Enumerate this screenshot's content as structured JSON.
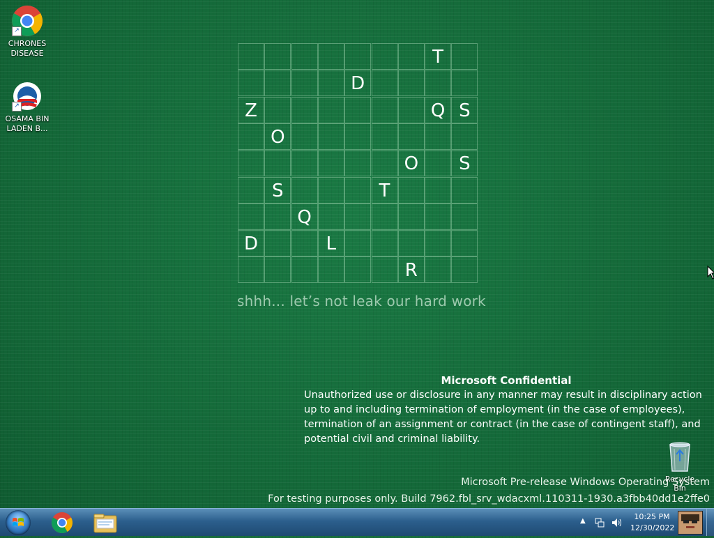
{
  "desktop": {
    "icons": [
      {
        "label": "CHRONES DISEASE",
        "icon": "chrome-icon"
      },
      {
        "label": "OSAMA BIN LADEN  B...",
        "icon": "obama-logo-icon"
      }
    ],
    "recycle_bin_label": "Recycle Bin"
  },
  "grid": {
    "size": 9,
    "letters": [
      {
        "row": 0,
        "col": 7,
        "ch": "T"
      },
      {
        "row": 1,
        "col": 4,
        "ch": "D"
      },
      {
        "row": 2,
        "col": 0,
        "ch": "Z"
      },
      {
        "row": 2,
        "col": 7,
        "ch": "Q"
      },
      {
        "row": 2,
        "col": 8,
        "ch": "S"
      },
      {
        "row": 3,
        "col": 1,
        "ch": "O"
      },
      {
        "row": 4,
        "col": 6,
        "ch": "O"
      },
      {
        "row": 4,
        "col": 8,
        "ch": "S"
      },
      {
        "row": 5,
        "col": 1,
        "ch": "S"
      },
      {
        "row": 5,
        "col": 5,
        "ch": "T"
      },
      {
        "row": 6,
        "col": 2,
        "ch": "Q"
      },
      {
        "row": 7,
        "col": 0,
        "ch": "D"
      },
      {
        "row": 7,
        "col": 3,
        "ch": "L"
      },
      {
        "row": 8,
        "col": 6,
        "ch": "R"
      }
    ],
    "caption": "shhh... let’s not leak our hard work"
  },
  "confidential": {
    "title": "Microsoft Confidential",
    "body": "Unauthorized use or disclosure in any manner may result in disciplinary action up to and including termination of employment (in the case of employees), termination of an assignment or contract (in the case of contingent staff), and potential civil and criminal liability."
  },
  "watermark": {
    "line1": "Microsoft Pre-release Windows Operating System",
    "line2": "For testing purposes only. Build 7962.fbl_srv_wdacxml.110311-1930.a3fbb40dd1e2ffe0"
  },
  "taskbar": {
    "pinned": [
      "chrome-icon",
      "file-explorer-icon"
    ],
    "tray": {
      "time": "10:25 PM",
      "date": "12/30/2022",
      "icons": [
        "show-hidden-icons-icon",
        "network-icon",
        "volume-icon"
      ]
    }
  }
}
